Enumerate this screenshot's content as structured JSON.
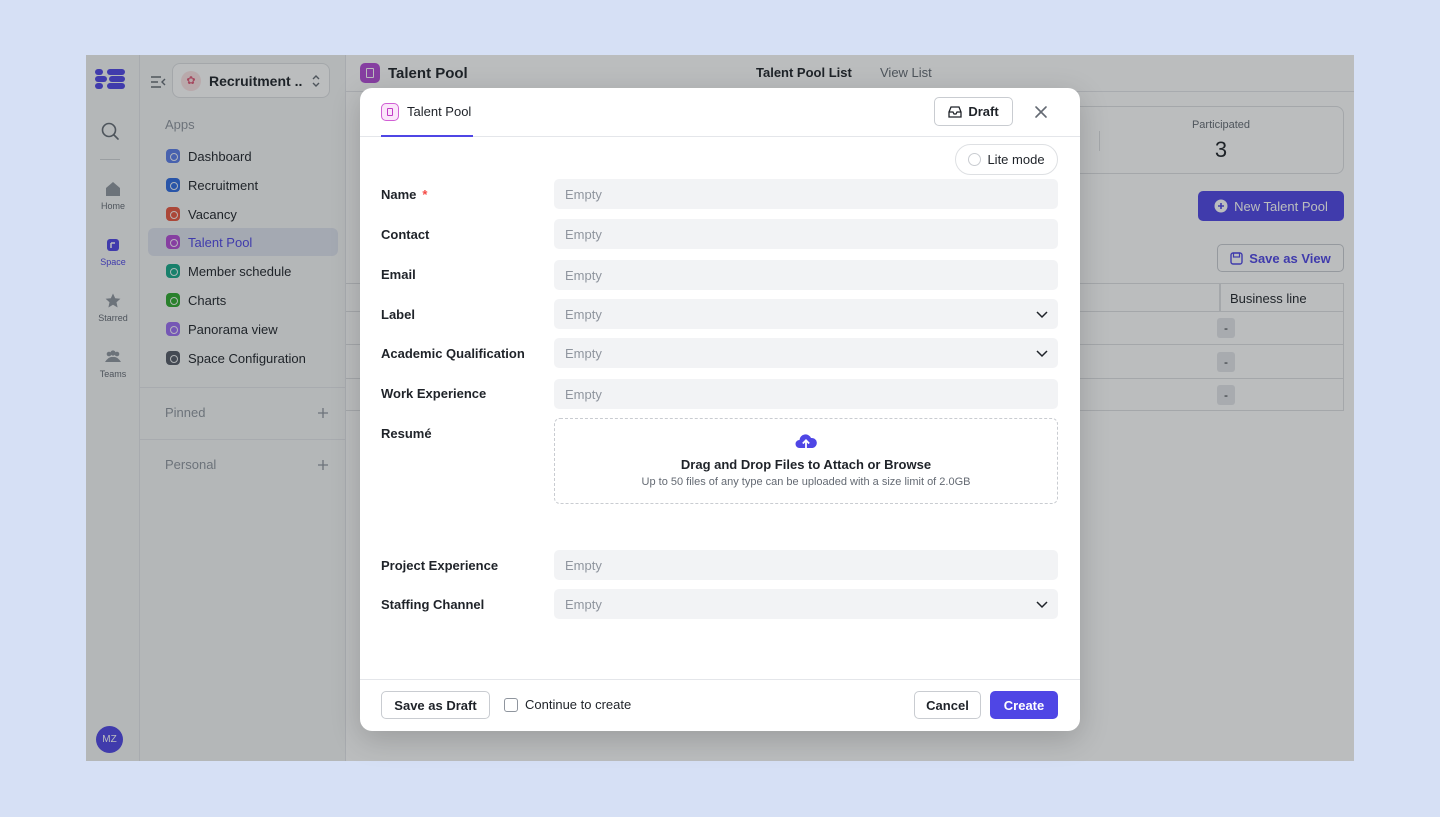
{
  "colors": {
    "accent": "#4f46e5",
    "page_bg": "#d6e0f5",
    "required": "#f54a45"
  },
  "rail": {
    "items": [
      {
        "label": "Home",
        "icon": "home-icon"
      },
      {
        "label": "Space",
        "icon": "space-icon"
      },
      {
        "label": "Starred",
        "icon": "star-icon"
      },
      {
        "label": "Teams",
        "icon": "teams-icon"
      }
    ],
    "avatar": "MZ"
  },
  "sidebar": {
    "space_name": "Recruitment ...",
    "apps_title": "Apps",
    "apps": [
      {
        "label": "Dashboard",
        "color": "#5b7de8"
      },
      {
        "label": "Recruitment",
        "color": "#2f6be0"
      },
      {
        "label": "Vacancy",
        "color": "#e8573f"
      },
      {
        "label": "Talent Pool",
        "color": "#b34bd6"
      },
      {
        "label": "Member schedule",
        "color": "#16a889"
      },
      {
        "label": "Charts",
        "color": "#2ea82e"
      },
      {
        "label": "Panorama view",
        "color": "#9b6ef3"
      },
      {
        "label": "Space Configuration",
        "color": "#555b66"
      }
    ],
    "pinned": "Pinned",
    "personal": "Personal"
  },
  "main": {
    "title": "Talent Pool",
    "tabs": [
      "Talent Pool List",
      "View List"
    ],
    "stat_label": "Participated",
    "stat_value": "3",
    "new_button": "New Talent Pool",
    "save_view_button": "Save as View",
    "column_header": "Business line",
    "rows": [
      "-",
      "-",
      "-"
    ]
  },
  "modal": {
    "tab_label": "Talent Pool",
    "draft_button": "Draft",
    "lite_mode": "Lite mode",
    "fields": [
      {
        "label": "Name",
        "placeholder": "Empty",
        "required": "*",
        "type": "text"
      },
      {
        "label": "Contact",
        "placeholder": "Empty",
        "type": "text"
      },
      {
        "label": "Email",
        "placeholder": "Empty",
        "type": "text"
      },
      {
        "label": "Label",
        "placeholder": "Empty",
        "type": "select"
      },
      {
        "label": "Academic Qualification",
        "placeholder": "Empty",
        "type": "select"
      },
      {
        "label": "Work Experience",
        "placeholder": "Empty",
        "type": "text"
      }
    ],
    "resume_label": "Resumé",
    "upload_title": "Drag and Drop Files to Attach or Browse",
    "upload_subtitle": "Up to 50 files of any type can be uploaded with a size limit of 2.0GB",
    "project_experience": {
      "label": "Project Experience",
      "placeholder": "Empty"
    },
    "staffing_channel": {
      "label": "Staffing Channel",
      "placeholder": "Empty"
    },
    "footer": {
      "save_draft": "Save as Draft",
      "continue": "Continue to create",
      "cancel": "Cancel",
      "create": "Create"
    }
  }
}
